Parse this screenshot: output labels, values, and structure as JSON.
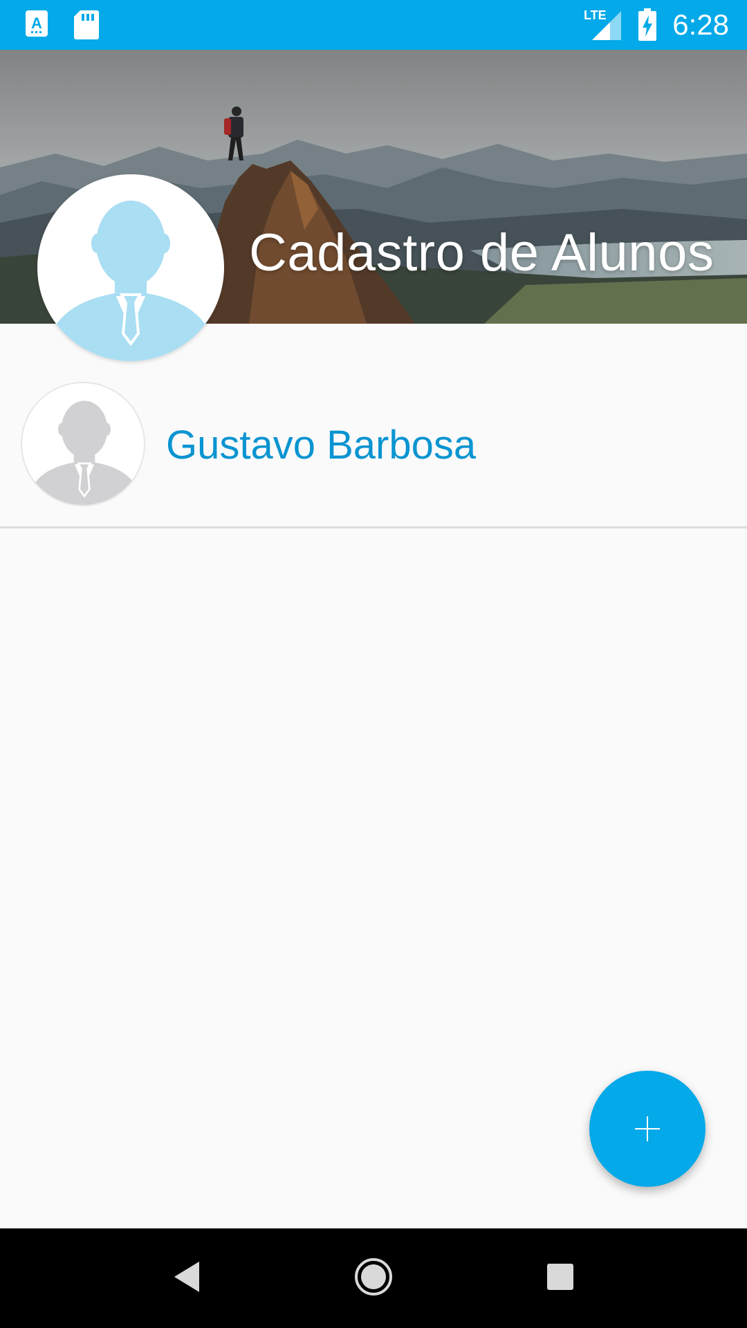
{
  "status_bar": {
    "time": "6:28",
    "network_label": "LTE",
    "icons": [
      "text-a-icon",
      "sd-card-icon",
      "lte-signal-icon",
      "battery-charging-icon"
    ],
    "background_color": "#03a9e8"
  },
  "header": {
    "title": "Cadastro de Alunos",
    "background": "mountain-landscape-image",
    "avatar_icon": "person-placeholder-icon",
    "avatar_color": "#a9def3"
  },
  "students": [
    {
      "name": "Gustavo Barbosa",
      "avatar_icon": "person-placeholder-icon",
      "avatar_color": "#d1d1d3"
    }
  ],
  "fab": {
    "icon": "plus-icon",
    "color": "#03a9e8"
  },
  "nav_bar": {
    "icons": [
      "back-icon",
      "home-icon",
      "recents-icon"
    ]
  },
  "colors": {
    "accent": "#03a9e8",
    "name_text": "#0a94d1"
  }
}
